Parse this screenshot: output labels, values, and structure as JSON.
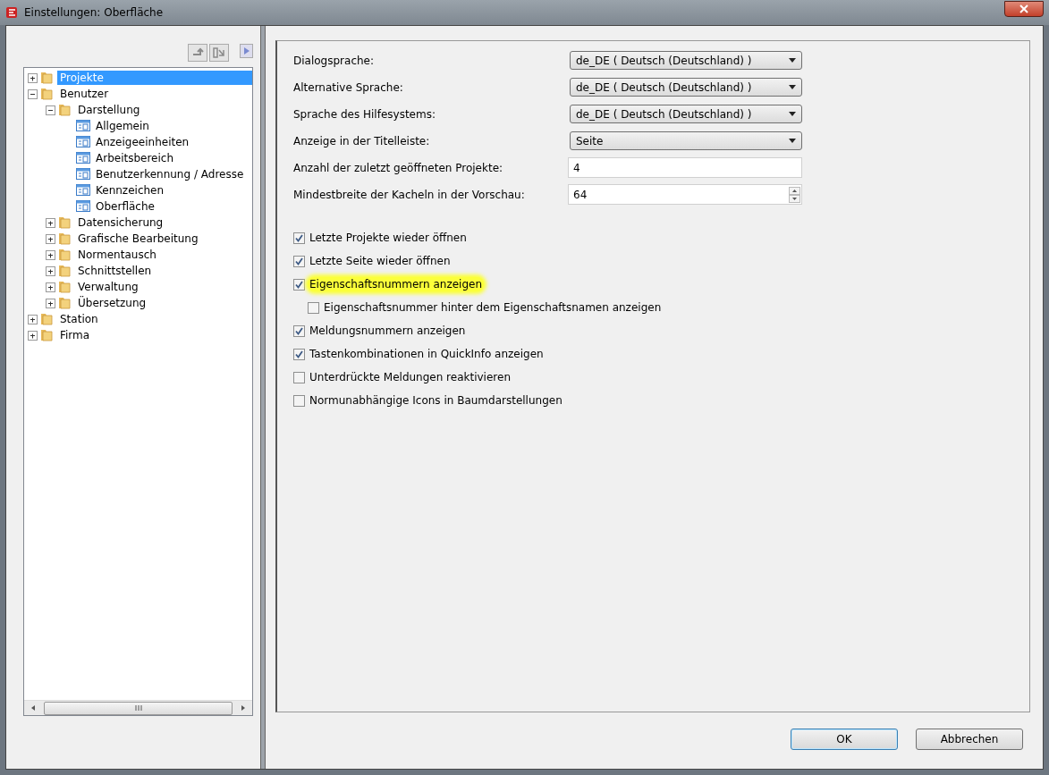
{
  "window": {
    "title": "Einstellungen: Oberfläche"
  },
  "tree": [
    {
      "label": "Projekte",
      "kind": "folder",
      "selected": true,
      "expanded": false
    },
    {
      "label": "Benutzer",
      "kind": "folder",
      "selected": false,
      "expanded": true,
      "children": [
        {
          "label": "Darstellung",
          "kind": "folder",
          "selected": false,
          "expanded": true,
          "children": [
            {
              "label": "Allgemein",
              "kind": "page",
              "selected": false
            },
            {
              "label": "Anzeigeeinheiten",
              "kind": "page",
              "selected": false
            },
            {
              "label": "Arbeitsbereich",
              "kind": "page",
              "selected": false
            },
            {
              "label": "Benutzerkennung / Adresse",
              "kind": "page",
              "selected": false
            },
            {
              "label": "Kennzeichen",
              "kind": "page",
              "selected": false
            },
            {
              "label": "Oberfläche",
              "kind": "page",
              "selected": false
            }
          ]
        },
        {
          "label": "Datensicherung",
          "kind": "folder",
          "selected": false,
          "expanded": false
        },
        {
          "label": "Grafische Bearbeitung",
          "kind": "folder",
          "selected": false,
          "expanded": false
        },
        {
          "label": "Normentausch",
          "kind": "folder",
          "selected": false,
          "expanded": false
        },
        {
          "label": "Schnittstellen",
          "kind": "folder",
          "selected": false,
          "expanded": false
        },
        {
          "label": "Verwaltung",
          "kind": "folder",
          "selected": false,
          "expanded": false
        },
        {
          "label": "Übersetzung",
          "kind": "folder",
          "selected": false,
          "expanded": false
        }
      ]
    },
    {
      "label": "Station",
      "kind": "folder",
      "selected": false,
      "expanded": false
    },
    {
      "label": "Firma",
      "kind": "folder",
      "selected": false,
      "expanded": false
    }
  ],
  "fields": [
    {
      "label": "Dialogsprache:",
      "kind": "dropdown",
      "value": "de_DE ( Deutsch (Deutschland) )"
    },
    {
      "label": "Alternative Sprache:",
      "kind": "dropdown",
      "value": "de_DE ( Deutsch (Deutschland) )"
    },
    {
      "label": "Sprache des Hilfesystems:",
      "kind": "dropdown",
      "value": "de_DE ( Deutsch (Deutschland) )"
    },
    {
      "label": "Anzeige in der Titelleiste:",
      "kind": "dropdown",
      "value": "Seite"
    },
    {
      "label": "Anzahl der zuletzt geöffneten Projekte:",
      "kind": "text",
      "value": "4"
    },
    {
      "label": "Mindestbreite der Kacheln in der Vorschau:",
      "kind": "spin",
      "value": "64"
    }
  ],
  "checkboxes": [
    {
      "label": "Letzte Projekte wieder öffnen",
      "checked": true,
      "highlighted": false
    },
    {
      "label": "Letzte Seite wieder öffnen",
      "checked": true,
      "highlighted": false
    },
    {
      "label": "Eigenschaftsnummern anzeigen",
      "checked": true,
      "highlighted": true,
      "children": [
        {
          "label": "Eigenschaftsnummer hinter dem Eigenschaftsnamen anzeigen",
          "checked": false,
          "highlighted": false
        }
      ]
    },
    {
      "label": "Meldungsnummern anzeigen",
      "checked": true,
      "highlighted": false
    },
    {
      "label": "Tastenkombinationen in QuickInfo anzeigen",
      "checked": true,
      "highlighted": false
    },
    {
      "label": "Unterdrückte Meldungen reaktivieren",
      "checked": false,
      "highlighted": false
    },
    {
      "label": "Normunabhängige Icons in Baumdarstellungen",
      "checked": false,
      "highlighted": false
    }
  ],
  "buttons": [
    {
      "label": "OK",
      "kind": "default"
    },
    {
      "label": "Abbrechen",
      "kind": "normal"
    }
  ]
}
